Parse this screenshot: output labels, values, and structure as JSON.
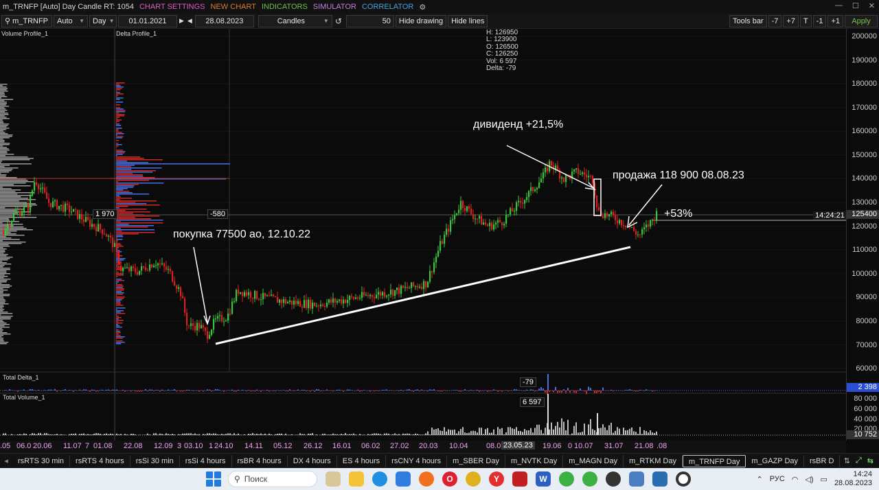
{
  "window": {
    "title": "m_TRNFP [Auto] Day Candle RT: 1054",
    "menu": [
      {
        "label": "CHART SETTINGS",
        "color": "#e05cc7"
      },
      {
        "label": "NEW CHART",
        "color": "#e07a2c"
      },
      {
        "label": "INDICATORS",
        "color": "#6cc24a"
      },
      {
        "label": "SIMULATOR",
        "color": "#c77fe0"
      },
      {
        "label": "CORRELATOR",
        "color": "#4aa3df"
      }
    ]
  },
  "toolbar": {
    "search_value": "m_TRNFP",
    "scale_mode": "Auto",
    "timeframe": "Day",
    "date_from": "01.01.2021",
    "date_to": "28.08.2023",
    "chart_type": "Candles",
    "bars_count": "50",
    "hide_drawing": "Hide drawing",
    "hide_lines": "Hide lines",
    "tools_bar": "Tools bar",
    "minus7": "-7",
    "plus7": "+7",
    "t": "T",
    "minus1": "-1",
    "plus1": "+1",
    "apply": "Apply"
  },
  "panels": {
    "volume_profile": "Volume Profile_1",
    "delta_profile": "Delta Profile_1",
    "total_delta": "Total Delta_1",
    "total_volume": "Total Volume_1"
  },
  "ohlc": {
    "h": "H: 126950",
    "l": "L: 123900",
    "o": "O: 126500",
    "c": "C: 126250",
    "vol": "Vol: 6 597",
    "delta": "Delta: -79"
  },
  "tags": {
    "vp_value": "1 970",
    "dp_value": "-580",
    "delta_value": "-79",
    "volume_value": "6 597",
    "time": "14:24:21",
    "last_price": "125400",
    "delta_axis": "2 398",
    "volume_axis": "10 752"
  },
  "annotations": {
    "buy": "покупка 77500 ао, 12.10.22",
    "dividend": "дивиденд +21,5%",
    "sell": "продажа 118 900 08.08.23",
    "gain": "+53%"
  },
  "price_axis": [
    "200000",
    "190000",
    "180000",
    "170000",
    "160000",
    "150000",
    "140000",
    "130000",
    "120000",
    "110000",
    "100000",
    "90000",
    "80000",
    "70000",
    "60000"
  ],
  "volume_axis": [
    "80 000",
    "60 000",
    "40 000",
    "20 000"
  ],
  "date_labels": [
    ".05",
    "06.0",
    "20.06",
    "11.07",
    "7",
    "01.08",
    "22.08",
    "12.09",
    "3",
    "03.10",
    "1",
    "24.10",
    "14.11",
    "05.12",
    "26.12",
    "16.01",
    "06.02",
    "27.02",
    "20.03",
    "10.04",
    "08.0",
    "23.05.23",
    "19.06",
    "0",
    "10.07",
    "31.07",
    "21.08",
    ".08"
  ],
  "tabs": [
    "rsRTS 30 min",
    "rsRTS 4 hours",
    "rsSi 30 min",
    "rsSi 4 hours",
    "rsBR 4 hours",
    "DX 4 hours",
    "ES 4 hours",
    "rsCNY 4 hours",
    "m_SBER Day",
    "m_NVTK Day",
    "m_MAGN Day",
    "m_RTKM Day",
    "m_TRNFP Day",
    "m_GAZP Day",
    "rsBR D"
  ],
  "active_tab": "m_TRNFP Day",
  "taskbar": {
    "search": "Поиск",
    "lang": "РУС",
    "time": "14:24",
    "date": "28.08.2023"
  },
  "colors": {
    "up": "#3cc43c",
    "down": "#e02020",
    "accent_blue": "#4a6fe0",
    "delta_red": "#e03030"
  },
  "chart_data": {
    "type": "candlestick",
    "symbol": "m_TRNFP",
    "timeframe": "Day",
    "ylim": [
      55000,
      205000
    ],
    "key_points": [
      {
        "date": "12.10.22",
        "price": 77500
      },
      {
        "date": "08.08.23",
        "price": 118900
      },
      {
        "date": "28.08.23",
        "price": 125400
      }
    ]
  }
}
